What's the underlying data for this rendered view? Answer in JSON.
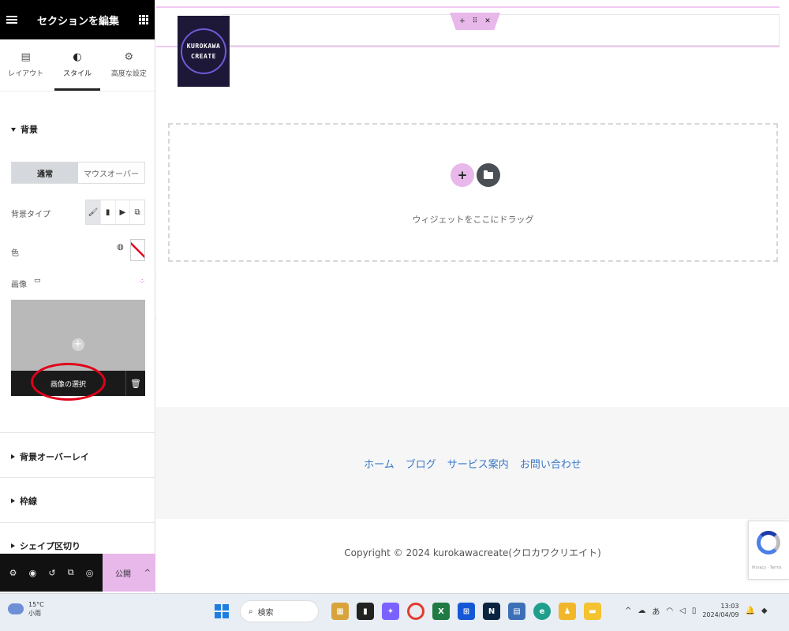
{
  "panel": {
    "title": "セクションを編集",
    "tabs": [
      {
        "label": "レイアウト",
        "icon": "layout-icon"
      },
      {
        "label": "スタイル",
        "icon": "style-icon"
      },
      {
        "label": "高度な設定",
        "icon": "gear-icon"
      }
    ],
    "active_tab": "スタイル",
    "background_section": "背景",
    "state_toggle": [
      "通常",
      "マウスオーバー"
    ],
    "background_type_label": "背景タイプ",
    "background_types": [
      "classic",
      "gradient",
      "video",
      "slideshow"
    ],
    "color_label": "色",
    "image_label": "画像",
    "select_image_label": "画像の選択",
    "sections": [
      "背景オーバーレイ",
      "枠線",
      "シェイプ区切り"
    ],
    "publish_label": "公開"
  },
  "canvas": {
    "logo_lines": [
      "KUROKAWA",
      "CREATE"
    ],
    "drop_text": "ウィジェットをここにドラッグ",
    "footer_nav": [
      "ホーム",
      "ブログ",
      "サービス案内",
      "お問い合わせ"
    ],
    "copyright": "Copyright © 2024 kurokawacreate(クロカワクリエイト)"
  },
  "taskbar": {
    "temperature": "15°C",
    "weather": "小雨",
    "search_placeholder": "検索",
    "time": "13:03",
    "date": "2024/04/09",
    "ime": "あ"
  },
  "colors": {
    "accent_pink": "#e8b8ea",
    "link_blue": "#3a78c9",
    "highlight_red": "#e0001a",
    "panel_header": "#000000"
  }
}
